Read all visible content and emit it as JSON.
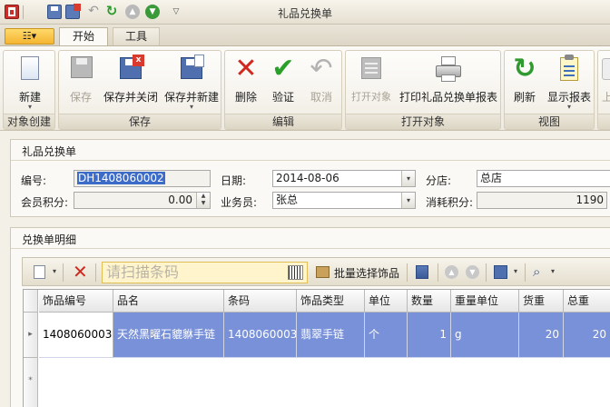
{
  "window": {
    "title": "礼品兑换单"
  },
  "tabs": [
    {
      "label": "开始",
      "active": true
    },
    {
      "label": "工具",
      "active": false
    }
  ],
  "ribbon": {
    "groups": [
      {
        "label": "对象创建",
        "buttons": [
          {
            "label": "新建",
            "icon": "new-document-icon",
            "enabled": true,
            "dropdown": true
          }
        ]
      },
      {
        "label": "保存",
        "buttons": [
          {
            "label": "保存",
            "icon": "save-icon",
            "enabled": false
          },
          {
            "label": "保存并关闭",
            "icon": "save-close-icon",
            "enabled": true
          },
          {
            "label": "保存并新建",
            "icon": "save-new-icon",
            "enabled": true,
            "dropdown": true
          }
        ]
      },
      {
        "label": "编辑",
        "buttons": [
          {
            "label": "删除",
            "icon": "delete-x-icon",
            "enabled": true
          },
          {
            "label": "验证",
            "icon": "checkmark-icon",
            "enabled": true
          },
          {
            "label": "取消",
            "icon": "undo-icon",
            "enabled": false
          }
        ]
      },
      {
        "label": "打开对象",
        "buttons": [
          {
            "label": "打开对象",
            "icon": "open-object-icon",
            "enabled": false
          },
          {
            "label": "打印礼品兑换单报表",
            "icon": "printer-icon",
            "enabled": true
          }
        ]
      },
      {
        "label": "视图",
        "buttons": [
          {
            "label": "刷新",
            "icon": "refresh-icon",
            "enabled": true
          },
          {
            "label": "显示报表",
            "icon": "report-icon",
            "enabled": true,
            "dropdown": true
          }
        ]
      },
      {
        "label": "",
        "buttons": [
          {
            "label": "上",
            "icon": "up-icon",
            "enabled": false
          }
        ]
      }
    ]
  },
  "header_form": {
    "title": "礼品兑换单",
    "fields": {
      "code": {
        "label": "编号:",
        "value": "DH1408060002"
      },
      "date": {
        "label": "日期:",
        "value": "2014-08-06"
      },
      "branch": {
        "label": "分店:",
        "value": "总店"
      },
      "member_points": {
        "label": "会员积分:",
        "value": "0.00"
      },
      "salesperson": {
        "label": "业务员:",
        "value": "张总"
      },
      "points_used": {
        "label": "消耗积分:",
        "value": "1190"
      }
    }
  },
  "details": {
    "title": "兑换单明细",
    "scan_placeholder": "请扫描条码",
    "batch_select_label": "批量选择饰品",
    "columns": [
      "饰品编号",
      "品名",
      "条码",
      "饰品类型",
      "单位",
      "数量",
      "重量单位",
      "货重",
      "总重"
    ],
    "rows": [
      {
        "code": "1408060003",
        "name": "天然黑曜石貔貅手链",
        "barcode": "1408060003",
        "type": "翡翠手链",
        "unit": "个",
        "qty": "1",
        "weight_unit": "g",
        "weight": "20",
        "total_weight": "20"
      }
    ],
    "new_row_marker": "*"
  },
  "colors": {
    "selection": "#7891d9",
    "accent": "#f4b532"
  }
}
